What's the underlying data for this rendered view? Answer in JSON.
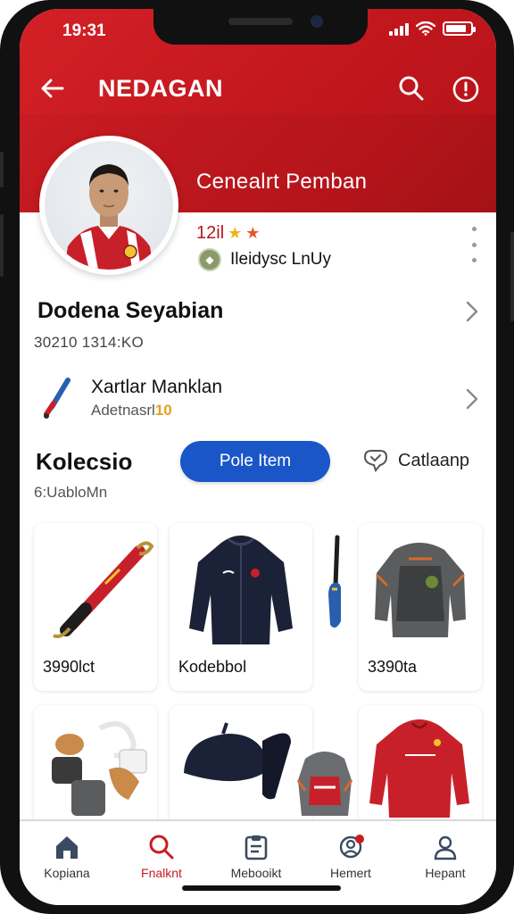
{
  "status_bar": {
    "time": "19:31",
    "battery_level": 0.85
  },
  "topbar": {
    "title": "NEDAGAN",
    "back_icon": "arrow-left-icon",
    "search_icon": "search-icon",
    "info_icon": "info-circle-icon"
  },
  "profile": {
    "name": "Cenealrt Pemban",
    "rating": "12il",
    "stars": 2,
    "badge_text": "Ileidysc LnUy",
    "badge_icon": "club-badge-icon"
  },
  "details": {
    "title": "Dodena Seyabian",
    "subtitle": "30210 1314:KO"
  },
  "featured_item": {
    "title": "Xartlar Manklan",
    "subtitle": "Adetnasrl",
    "subtitle_accent": "10",
    "icon": "racket-icon"
  },
  "collection": {
    "title": "Kolecsio",
    "subtitle": "6:UabloMn",
    "primary_button": "Pole Item",
    "secondary_button": "Catlaanp",
    "secondary_icon": "heart-chat-icon",
    "items": [
      {
        "label": "3990lct",
        "icon": "bat-icon"
      },
      {
        "label": "Kodebbol",
        "icon": "jacket-icon"
      },
      {
        "label": "",
        "icon": "paddle-icon"
      },
      {
        "label": "3390ta",
        "icon": "armor-jacket-icon"
      },
      {
        "label": "",
        "icon": "gloves-set-icon"
      },
      {
        "label": "",
        "icon": "cap-icon"
      },
      {
        "label": "",
        "icon": "backpack-icon"
      },
      {
        "label": "",
        "icon": "red-jacket-icon"
      }
    ]
  },
  "bottom_nav": [
    {
      "label": "Kopiana",
      "icon": "home-icon",
      "active": false
    },
    {
      "label": "Fnalknt",
      "icon": "search-icon",
      "active": true
    },
    {
      "label": "Mebooikt",
      "icon": "clipboard-icon",
      "active": false
    },
    {
      "label": "Hemert",
      "icon": "notification-user-icon",
      "active": false
    },
    {
      "label": "Hepant",
      "icon": "profile-icon",
      "active": false
    }
  ],
  "colors": {
    "brand_red": "#c81c22",
    "primary_blue": "#1a56c8",
    "accent_gold": "#e6a020"
  }
}
